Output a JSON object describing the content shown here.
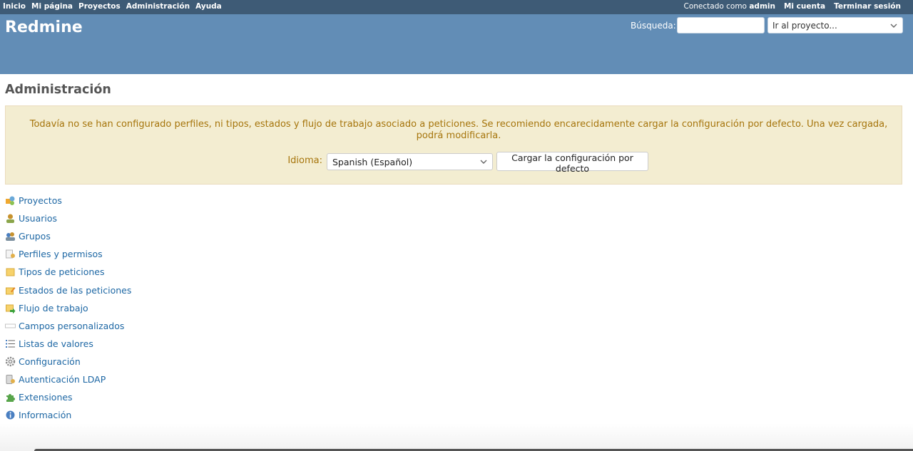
{
  "top_menu": {
    "left": [
      "Inicio",
      "Mi página",
      "Proyectos",
      "Administración",
      "Ayuda"
    ],
    "logged_prefix": "Conectado como",
    "user": "admin",
    "my_account": "Mi cuenta",
    "logout": "Terminar sesión"
  },
  "header": {
    "app_title": "Redmine",
    "search_label": "Búsqueda:",
    "search_value": "",
    "project_select": "Ir al proyecto..."
  },
  "page": {
    "title": "Administración",
    "warning": {
      "message": "Todavía no se han configurado perfiles, ni tipos, estados y flujo de trabajo asociado a peticiones. Se recomiendo encarecidamente cargar la configuración por defecto. Una vez cargada, podrá modificarla.",
      "lang_label": "Idioma:",
      "lang_value": "Spanish (Español)",
      "button": "Cargar la configuración por defecto"
    },
    "admin_menu": [
      {
        "label": "Proyectos",
        "icon": "projects-icon"
      },
      {
        "label": "Usuarios",
        "icon": "user-icon"
      },
      {
        "label": "Grupos",
        "icon": "group-icon"
      },
      {
        "label": "Perfiles y permisos",
        "icon": "roles-icon"
      },
      {
        "label": "Tipos de peticiones",
        "icon": "tracker-icon"
      },
      {
        "label": "Estados de las peticiones",
        "icon": "issue-status-icon"
      },
      {
        "label": "Flujo de trabajo",
        "icon": "workflow-icon"
      },
      {
        "label": "Campos personalizados",
        "icon": "custom-field-icon"
      },
      {
        "label": "Listas de valores",
        "icon": "list-icon"
      },
      {
        "label": "Configuración",
        "icon": "gear-icon"
      },
      {
        "label": "Autenticación LDAP",
        "icon": "server-key-icon"
      },
      {
        "label": "Extensiones",
        "icon": "plugin-icon"
      },
      {
        "label": "Información",
        "icon": "info-icon"
      }
    ]
  },
  "colors": {
    "top_bar": "#3e5b76",
    "header": "#628db6",
    "link": "#1d67a4",
    "warning_bg": "#f3edd1",
    "warning_text": "#a6750c"
  }
}
